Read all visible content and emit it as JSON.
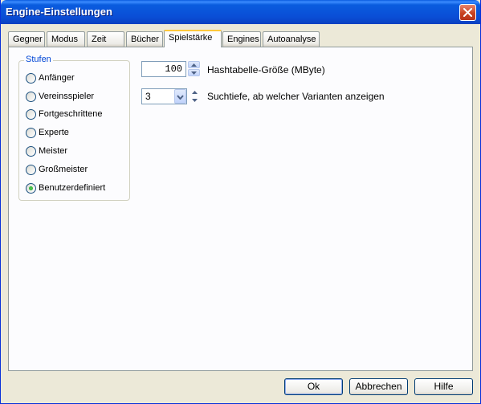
{
  "window": {
    "title": "Engine-Einstellungen"
  },
  "tabs": [
    {
      "label": "Gegner"
    },
    {
      "label": "Modus"
    },
    {
      "label": "Zeit"
    },
    {
      "label": "Bücher"
    },
    {
      "label": "Spielstärke",
      "active": true
    },
    {
      "label": "Engines"
    },
    {
      "label": "Autoanalyse"
    }
  ],
  "levels": {
    "title": "Stufen",
    "options": [
      {
        "label": "Anfänger",
        "checked": false
      },
      {
        "label": "Vereinsspieler",
        "checked": false
      },
      {
        "label": "Fortgeschrittene",
        "checked": false
      },
      {
        "label": "Experte",
        "checked": false
      },
      {
        "label": "Meister",
        "checked": false
      },
      {
        "label": "Großmeister",
        "checked": false
      },
      {
        "label": "Benutzerdefiniert",
        "checked": true
      }
    ]
  },
  "hash": {
    "value": "100",
    "label": "Hashtabelle-Größe (MByte)"
  },
  "depth": {
    "value": "3",
    "label": "Suchtiefe, ab welcher Varianten anzeigen"
  },
  "buttons": {
    "ok": "Ok",
    "cancel": "Abbrechen",
    "help": "Hilfe"
  },
  "colors": {
    "titlebar": "#0a4ed6",
    "active_tab_accent": "#ffc83c",
    "group_title": "#0046d5",
    "radio_checked": "#21a121"
  }
}
